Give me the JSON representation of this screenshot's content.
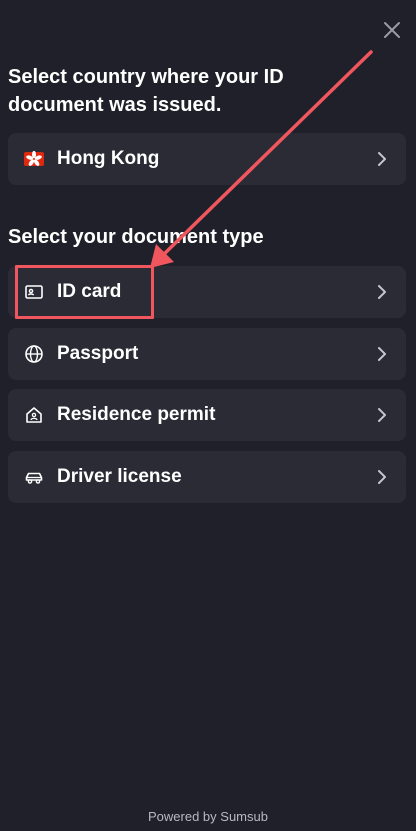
{
  "close": {
    "icon": "close-icon"
  },
  "country_section": {
    "heading": "Select country where your ID document was issued.",
    "selected_country": {
      "label": "Hong Kong",
      "icon": "hong-kong-flag-icon"
    }
  },
  "document_section": {
    "heading": "Select your document type",
    "items": [
      {
        "label": "ID card",
        "icon": "id-card-icon"
      },
      {
        "label": "Passport",
        "icon": "globe-icon"
      },
      {
        "label": "Residence permit",
        "icon": "house-icon"
      },
      {
        "label": "Driver license",
        "icon": "car-icon"
      }
    ]
  },
  "annotation": {
    "color": "#f0565e",
    "target": "ID card"
  },
  "footer": {
    "text": "Powered by Sumsub"
  },
  "colors": {
    "background": "#1f2029",
    "row_background": "#2a2b35",
    "text": "#ffffff",
    "muted_text": "#b7b8c2"
  }
}
